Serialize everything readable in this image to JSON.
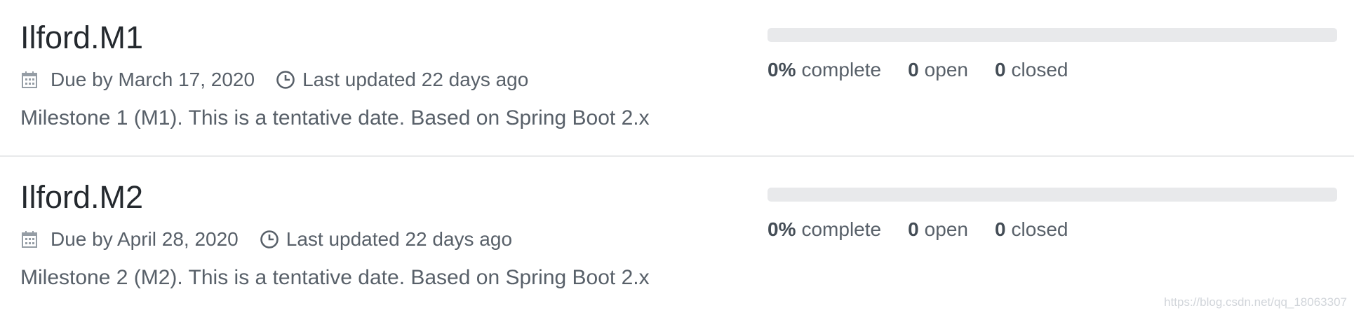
{
  "milestones": [
    {
      "title": "Ilford.M1",
      "due": "Due by March 17, 2020",
      "updated": "Last updated 22 days ago",
      "description": "Milestone 1 (M1). This is a tentative date. Based on Spring Boot 2.x",
      "progress": {
        "percent": 0,
        "percent_label": "0%",
        "complete_label": "complete"
      },
      "open": {
        "count": "0",
        "label": "open"
      },
      "closed": {
        "count": "0",
        "label": "closed"
      }
    },
    {
      "title": "Ilford.M2",
      "due": "Due by April 28, 2020",
      "updated": "Last updated 22 days ago",
      "description": "Milestone 2 (M2). This is a tentative date. Based on Spring Boot 2.x",
      "progress": {
        "percent": 0,
        "percent_label": "0%",
        "complete_label": "complete"
      },
      "open": {
        "count": "0",
        "label": "open"
      },
      "closed": {
        "count": "0",
        "label": "closed"
      }
    }
  ],
  "icons": {
    "due": "calendar-icon",
    "updated": "clock-icon"
  },
  "colors": {
    "title": "#24292e",
    "muted": "#586069",
    "track": "#e8e9eb",
    "fill": "#28a745"
  },
  "watermark": "https://blog.csdn.net/qq_18063307"
}
